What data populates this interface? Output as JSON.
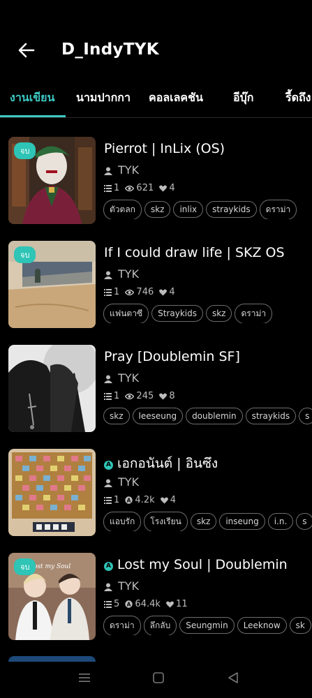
{
  "header": {
    "title": "D_IndyTYK"
  },
  "tabs": [
    "งานเขียน",
    "นามปากกา",
    "คอลเลคชัน",
    "อีบุ๊ก",
    "รี้ดถึง"
  ],
  "stories": [
    {
      "badge": "จบ",
      "title": "Pierrot | InLix (OS)",
      "author": "TYK",
      "chapters": "1",
      "views": "621",
      "likes": "4",
      "tags": [
        "ตัวตลก",
        "skz",
        "inlix",
        "straykids",
        "ดราม่า"
      ]
    },
    {
      "badge": "จบ",
      "title": "If I could draw life | SKZ OS",
      "author": "TYK",
      "chapters": "1",
      "views": "746",
      "likes": "4",
      "tags": [
        "แฟนตาซี",
        "Straykids",
        "skz",
        "ดราม่า"
      ]
    },
    {
      "badge": "",
      "title": "Pray [Doublemin SF]",
      "author": "TYK",
      "chapters": "1",
      "views": "245",
      "likes": "8",
      "tags": [
        "skz",
        "leeseung",
        "doublemin",
        "straykids",
        "s"
      ]
    },
    {
      "badge": "",
      "title": "เอกอนันต์ | อินซึง",
      "author": "TYK",
      "chapters": "1",
      "views": "4.2k",
      "likes": "4",
      "tags": [
        "แอบรัก",
        "โรงเรียน",
        "skz",
        "inseung",
        "i.n.",
        "s"
      ]
    },
    {
      "badge": "จบ",
      "title": "Lost my Soul | Doublemin",
      "author": "TYK",
      "chapters": "5",
      "views": "64.4k",
      "likes": "11",
      "tags": [
        "ดราม่า",
        "ลึกลับ",
        "Seungmin",
        "Leeknow",
        "sk"
      ]
    }
  ],
  "colors": {
    "accent": "#3cc9c2",
    "badge": "#2ec4b6",
    "background": "#000000"
  }
}
